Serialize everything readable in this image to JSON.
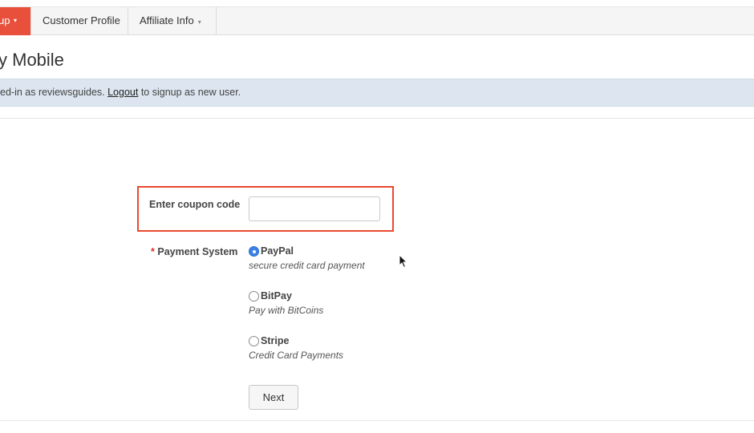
{
  "nav": {
    "tabs": [
      {
        "label": "up",
        "has_dropdown": true,
        "active": true
      },
      {
        "label": "Customer Profile",
        "has_dropdown": false,
        "active": false
      },
      {
        "label": "Affiliate Info",
        "has_dropdown": true,
        "active": false
      }
    ],
    "caret": "▾"
  },
  "page": {
    "title": "y Mobile"
  },
  "info_bar": {
    "prefix": "ed-in as reviewsguides. ",
    "logout_link": "Logout",
    "suffix": " to signup as new user."
  },
  "form": {
    "coupon": {
      "label": "Enter coupon code",
      "value": "",
      "placeholder": ""
    },
    "payment": {
      "required_mark": "*",
      "label": "Payment System",
      "options": [
        {
          "name": "PayPal",
          "description": "secure credit card payment",
          "selected": true
        },
        {
          "name": "BitPay",
          "description": "Pay with BitCoins",
          "selected": false
        },
        {
          "name": "Stripe",
          "description": "Credit Card Payments",
          "selected": false
        }
      ]
    },
    "next_label": "Next"
  },
  "colors": {
    "active_tab": "#e8503b",
    "highlight_border": "#e84a2e",
    "info_bar_bg": "#dde6f0",
    "radio_selected": "#3b82e6",
    "required": "#d9332b"
  }
}
